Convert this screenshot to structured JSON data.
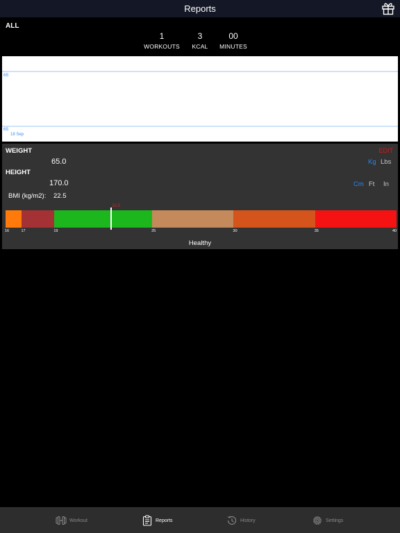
{
  "header": {
    "title": "Reports",
    "gift_icon": "gift-icon"
  },
  "summary": {
    "filter_label": "ALL",
    "stats": [
      {
        "value": "1",
        "label": "WORKOUTS"
      },
      {
        "value": "3",
        "label": "KCAL"
      },
      {
        "value": "00",
        "label": "MINUTES"
      }
    ]
  },
  "weight_chart": {
    "grid_labels": [
      "65",
      "65"
    ],
    "x_label": "18 Sep",
    "line_color": "#3b8ee8"
  },
  "body": {
    "weight_label": "WEIGHT",
    "weight_value": "65.0",
    "edit_label": "EDIT",
    "weight_units": [
      "Kg",
      "Lbs"
    ],
    "weight_unit_selected": "Kg",
    "height_label": "HEIGHT",
    "height_value": "170.0",
    "height_units": [
      "Cm",
      "Ft",
      "In"
    ],
    "height_unit_selected": "Cm",
    "bmi_label": "BMI (kg/m2):",
    "bmi_value": "22.5",
    "bmi_status": "Healthy",
    "bmi_marker_value": 22.5,
    "bmi_marker_text": "22.5",
    "bmi_scale": {
      "min": 16,
      "max": 40,
      "ticks": [
        "16",
        "17",
        "19",
        "25",
        "30",
        "35",
        "40"
      ],
      "segments": [
        {
          "from": 16,
          "to": 17,
          "color": "#ff7a0a"
        },
        {
          "from": 17,
          "to": 19,
          "color": "#a43234"
        },
        {
          "from": 19,
          "to": 25,
          "color": "#1cb71c"
        },
        {
          "from": 25,
          "to": 30,
          "color": "#c48a5c"
        },
        {
          "from": 30,
          "to": 35,
          "color": "#d5541c"
        },
        {
          "from": 35,
          "to": 40,
          "color": "#f41212"
        }
      ]
    }
  },
  "tabs": [
    {
      "label": "Workout",
      "icon": "dumbbell-icon",
      "active": false
    },
    {
      "label": "Reports",
      "icon": "clipboard-icon",
      "active": true
    },
    {
      "label": "History",
      "icon": "history-icon",
      "active": false
    },
    {
      "label": "Settings",
      "icon": "gear-icon",
      "active": false
    }
  ]
}
